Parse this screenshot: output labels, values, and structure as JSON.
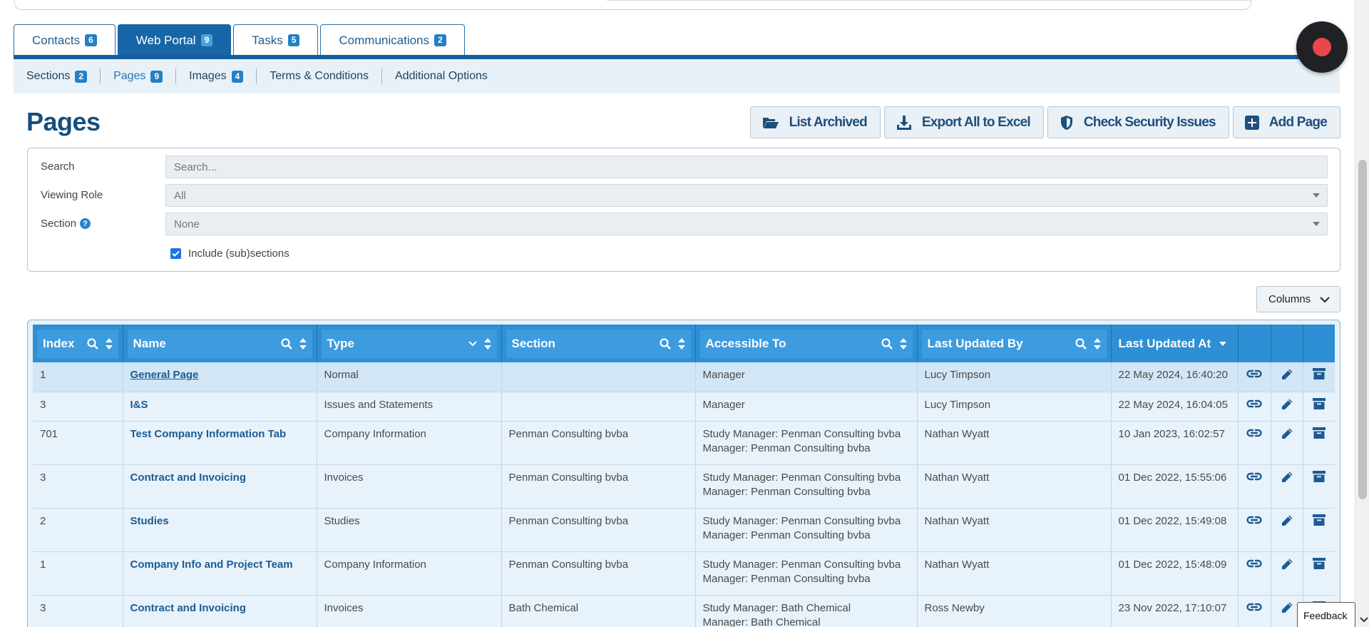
{
  "main_tabs": [
    {
      "label": "Contacts",
      "count": "6"
    },
    {
      "label": "Web Portal",
      "count": "9"
    },
    {
      "label": "Tasks",
      "count": "5"
    },
    {
      "label": "Communications",
      "count": "2"
    }
  ],
  "sub_nav": [
    {
      "label": "Sections",
      "count": "2"
    },
    {
      "label": "Pages",
      "count": "9"
    },
    {
      "label": "Images",
      "count": "4"
    },
    {
      "label": "Terms & Conditions"
    },
    {
      "label": "Additional Options"
    }
  ],
  "page_title": "Pages",
  "actions": {
    "list_archived": "List Archived",
    "export": "Export All to Excel",
    "security": "Check Security Issues",
    "add_page": "Add Page"
  },
  "filters": {
    "search_label": "Search",
    "search_placeholder": "Search...",
    "role_label": "Viewing Role",
    "role_value": "All",
    "section_label": "Section",
    "section_value": "None",
    "include_label": "Include (sub)sections"
  },
  "columns_button": "Columns",
  "table": {
    "headers": {
      "index": "Index",
      "name": "Name",
      "type": "Type",
      "section": "Section",
      "accessible": "Accessible To",
      "updated_by": "Last Updated By",
      "updated_at": "Last Updated At"
    },
    "rows": [
      {
        "index": "1",
        "name": "General Page",
        "type": "Normal",
        "section": "",
        "access1": "Manager",
        "access2": "",
        "by": "Lucy Timpson",
        "at": "22 May 2024, 16:40:20"
      },
      {
        "index": "3",
        "name": "I&S",
        "type": "Issues and Statements",
        "section": "",
        "access1": "Manager",
        "access2": "",
        "by": "Lucy Timpson",
        "at": "22 May 2024, 16:04:05"
      },
      {
        "index": "701",
        "name": "Test Company Information Tab",
        "type": "Company Information",
        "section": "Penman Consulting bvba",
        "access1": "Study Manager: Penman Consulting bvba",
        "access2": "Manager: Penman Consulting bvba",
        "by": "Nathan Wyatt",
        "at": "10 Jan 2023, 16:02:57"
      },
      {
        "index": "3",
        "name": "Contract and Invoicing",
        "type": "Invoices",
        "section": "Penman Consulting bvba",
        "access1": "Study Manager: Penman Consulting bvba",
        "access2": "Manager: Penman Consulting bvba",
        "by": "Nathan Wyatt",
        "at": "01 Dec 2022, 15:55:06"
      },
      {
        "index": "2",
        "name": "Studies",
        "type": "Studies",
        "section": "Penman Consulting bvba",
        "access1": "Study Manager: Penman Consulting bvba",
        "access2": "Manager: Penman Consulting bvba",
        "by": "Nathan Wyatt",
        "at": "01 Dec 2022, 15:49:08"
      },
      {
        "index": "1",
        "name": "Company Info and Project Team",
        "type": "Company Information",
        "section": "Penman Consulting bvba",
        "access1": "Study Manager: Penman Consulting bvba",
        "access2": "Manager: Penman Consulting bvba",
        "by": "Nathan Wyatt",
        "at": "01 Dec 2022, 15:48:09"
      },
      {
        "index": "3",
        "name": "Contract and Invoicing",
        "type": "Invoices",
        "section": "Bath Chemical",
        "access1": "Study Manager: Bath Chemical",
        "access2": "Manager: Bath Chemical",
        "by": "Ross Newby",
        "at": "23 Nov 2022, 17:10:07"
      }
    ]
  },
  "feedback": "Feedback",
  "colors": {
    "brand_dark": "#175e9c",
    "header_blue": "#2f8fd4",
    "badge": "#2480c3",
    "record_red": "#e8474c"
  }
}
